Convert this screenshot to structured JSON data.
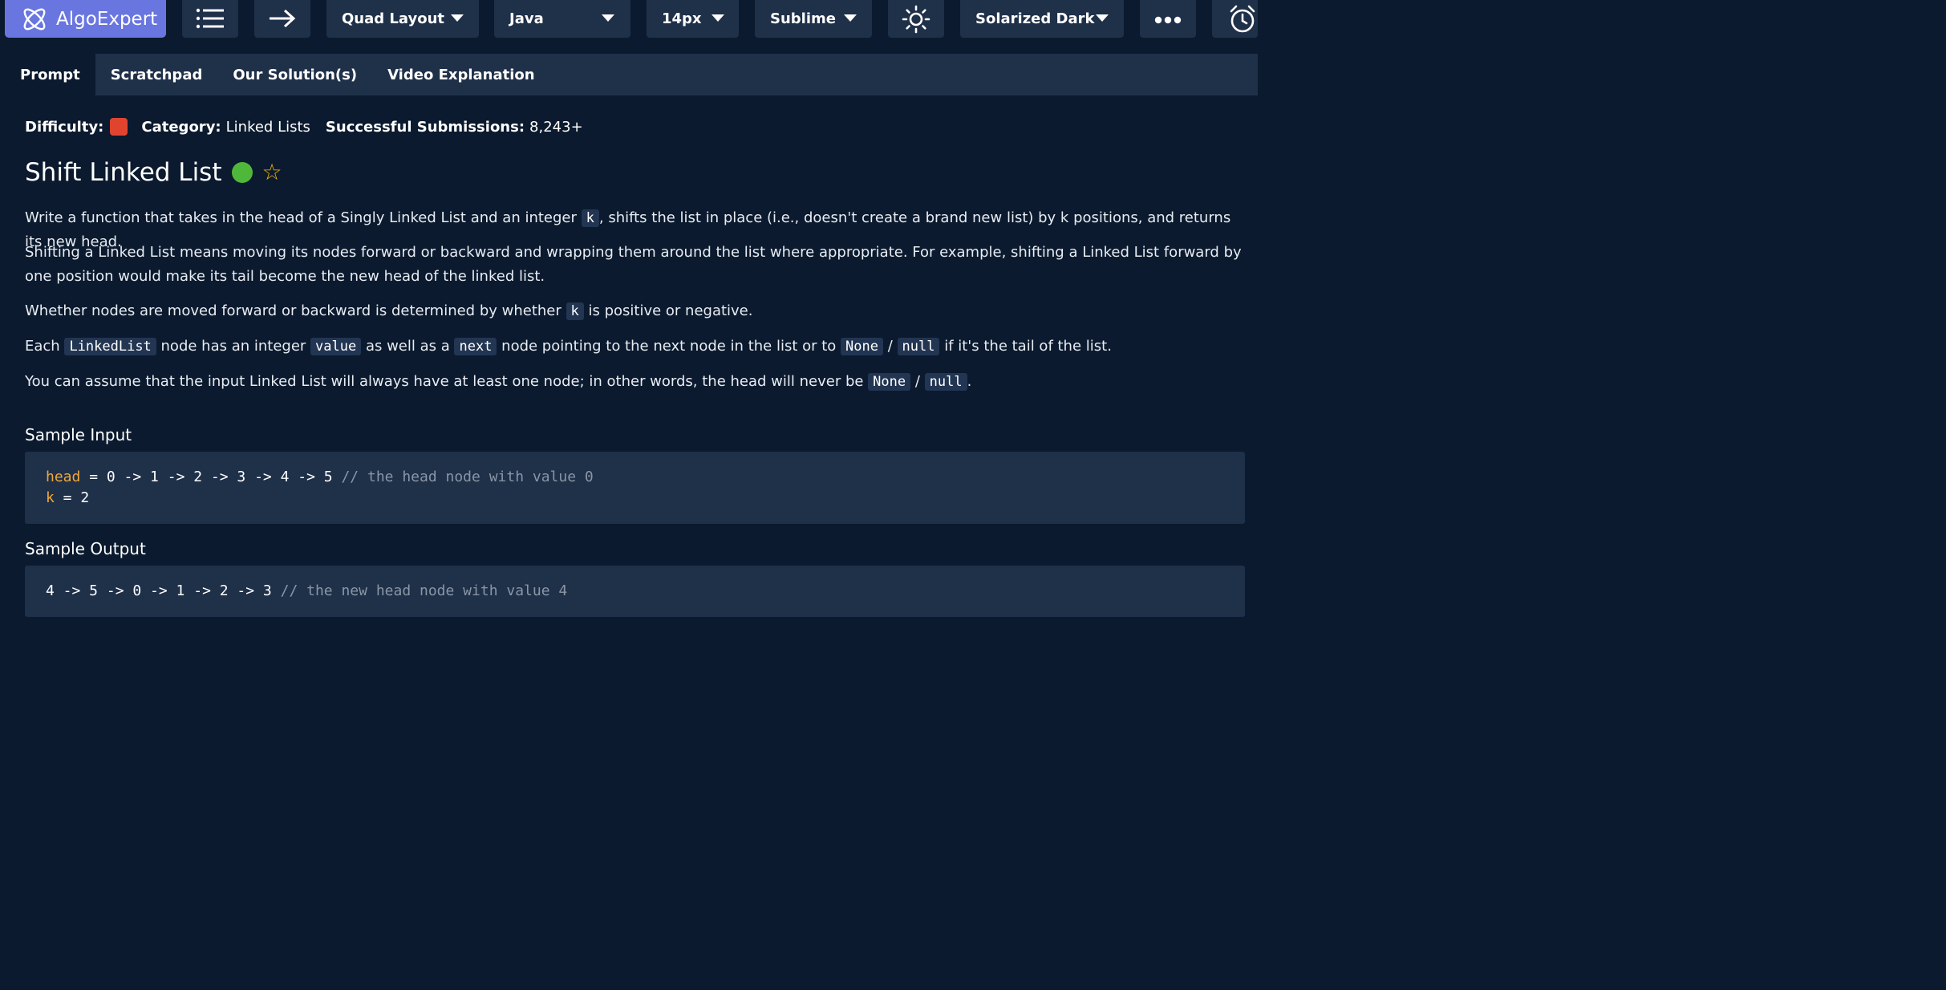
{
  "toolbar": {
    "logo_text": "AlgoExpert",
    "layout_label": "Quad Layout",
    "language_label": "Java",
    "font_size_label": "14px",
    "keymap_label": "Sublime",
    "theme_label": "Solarized Dark"
  },
  "tabs": [
    "Prompt",
    "Scratchpad",
    "Our Solution(s)",
    "Video Explanation"
  ],
  "meta": {
    "difficulty_label": "Difficulty:",
    "difficulty_color": "#e0442f",
    "category_label": "Category:",
    "category_value": "Linked Lists",
    "submissions_label": "Successful Submissions:",
    "submissions_value": "8,243+"
  },
  "problem": {
    "title": "Shift Linked List",
    "status_color": "#4fb83a"
  },
  "prompt": {
    "p1_a": "Write a function that takes in the head of a Singly Linked List and an integer ",
    "p1_code": "k",
    "p1_b": ", shifts the list in place (i.e., doesn't create a brand new list) by k positions, and returns its new head.",
    "p2": "Shifting a Linked List means moving its nodes forward or backward and wrapping them around the list where appropriate. For example, shifting a Linked List forward by one position would make its tail become the new head of the linked list.",
    "p3_a": "Whether nodes are moved forward or backward is determined by whether ",
    "p3_code": "k",
    "p3_b": " is positive or negative.",
    "p4_a": "Each ",
    "p4_code1": "LinkedList",
    "p4_b": " node has an integer ",
    "p4_code2": "value",
    "p4_c": " as well as a ",
    "p4_code3": "next",
    "p4_d": " node pointing to the next node in the list or to ",
    "p4_code4": "None",
    "p4_sep": " / ",
    "p4_code5": "null",
    "p4_e": " if it's the tail of the list.",
    "p5_a": "You can assume that the input Linked List will always have at least one node; in other words, the head will never be ",
    "p5_code1": "None",
    "p5_sep": " / ",
    "p5_code2": "null",
    "p5_b": "."
  },
  "sample_input": {
    "title": "Sample Input",
    "line1_var": "head",
    "line1_rest": " = 0 -> 1 -> 2 -> 3 -> 4 -> 5 ",
    "line1_comment": "// the head node with value 0",
    "line2_var": "k",
    "line2_rest": " = 2"
  },
  "sample_output": {
    "title": "Sample Output",
    "line1": "4 -> 5 -> 0 -> 1 -> 2 -> 3 ",
    "line1_comment": "// the new head node with value 4"
  }
}
